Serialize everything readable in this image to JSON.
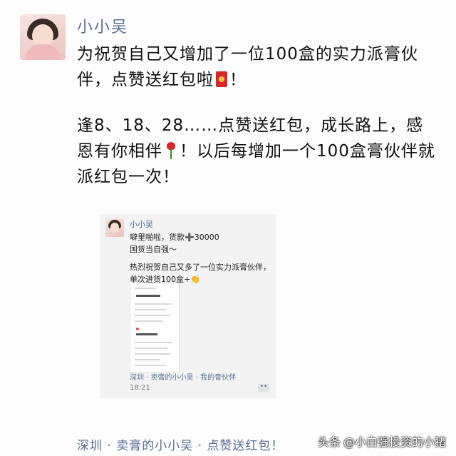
{
  "post": {
    "author": "小小吴",
    "paragraph1": {
      "text_before": "为祝贺自己又增加了一位100盒的实力派膏伙伴，点赞送红包啦",
      "emoji": "red-envelope-icon",
      "text_after": "！"
    },
    "paragraph2": {
      "text_before": "逢8、18、28……点赞送红包，成长路上，感恩有你相伴",
      "emoji": "rose-icon",
      "text_after": "！以后每增加一个100盒膏伙伴就派红包一次！"
    },
    "location_footer": "深圳 · 卖膏的小小吴 · 点赞送红包！"
  },
  "embedded": {
    "author": "小小吴",
    "line1": "噼里啪啦，货款➕30000",
    "line2": "国货当自强～",
    "line3": "热烈祝贺自己又多了一位实力派膏伙伴，单次进货100盒+👏",
    "footer": "深圳 · 卖膏的小小吴 · 我的膏伙伴",
    "time": "18:21",
    "more": "••"
  },
  "watermark": {
    "prefix": "头条",
    "text": "@小白强投资的小猪"
  },
  "colors": {
    "name_blue": "#5a6e96",
    "text": "#111111",
    "background": "#fdfdfd"
  }
}
